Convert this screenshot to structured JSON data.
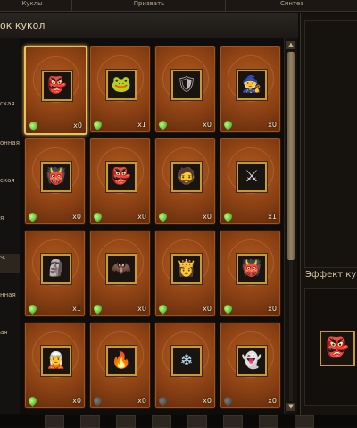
{
  "tabs": [
    {
      "label": "Куклы",
      "active": true
    },
    {
      "label": "Призвать",
      "active": false
    },
    {
      "label": "Синтез",
      "active": false
    }
  ],
  "header": {
    "title": "ок кукол"
  },
  "left_items": [
    {
      "label": "ская",
      "active": false
    },
    {
      "label": "онная",
      "active": false
    },
    {
      "label": "ская",
      "active": false
    },
    {
      "label": "я",
      "active": false
    },
    {
      "label": "ч.",
      "active": true
    },
    {
      "label": "нная",
      "active": false
    },
    {
      "label": "ая",
      "active": false
    }
  ],
  "dolls": [
    {
      "icon": "blue-imp-icon",
      "glyph": "👺",
      "color": "#5d8fd6",
      "count": "x0",
      "status": "on",
      "selected": true
    },
    {
      "icon": "frog-icon",
      "glyph": "🐸",
      "color": "#6fb04a",
      "count": "x1",
      "status": "on",
      "selected": false
    },
    {
      "icon": "armored-knight-icon",
      "glyph": "🛡",
      "color": "#b9b9b9",
      "count": "x0",
      "status": "on",
      "selected": false
    },
    {
      "icon": "witch-icon",
      "glyph": "🧙",
      "color": "#b07ad8",
      "count": "x0",
      "status": "on",
      "selected": false
    },
    {
      "icon": "red-demon-icon",
      "glyph": "👹",
      "color": "#d84b3a",
      "count": "x0",
      "status": "on",
      "selected": false
    },
    {
      "icon": "goblin-icon",
      "glyph": "👺",
      "color": "#7aa048",
      "count": "x0",
      "status": "on",
      "selected": false
    },
    {
      "icon": "dwarf-icon",
      "glyph": "🧔",
      "color": "#e8e0c8",
      "count": "x0",
      "status": "on",
      "selected": false
    },
    {
      "icon": "silver-knight-icon",
      "glyph": "⚔",
      "color": "#d8d8e8",
      "count": "x1",
      "status": "on",
      "selected": false
    },
    {
      "icon": "stone-golem-icon",
      "glyph": "🗿",
      "color": "#a8a08a",
      "count": "x1",
      "status": "on",
      "selected": false
    },
    {
      "icon": "dark-warlord-icon",
      "glyph": "🦇",
      "color": "#b05050",
      "count": "x0",
      "status": "on",
      "selected": false
    },
    {
      "icon": "warrior-woman-icon",
      "glyph": "👸",
      "color": "#d8a080",
      "count": "x0",
      "status": "on",
      "selected": false
    },
    {
      "icon": "orc-icon",
      "glyph": "👹",
      "color": "#c8905a",
      "count": "x0",
      "status": "on",
      "selected": false
    },
    {
      "icon": "mage-icon",
      "glyph": "🧝",
      "color": "#c8c8d8",
      "count": "x0",
      "status": "on",
      "selected": false
    },
    {
      "icon": "fire-spirit-icon",
      "glyph": "🔥",
      "color": "#ff8a2a",
      "count": "x0",
      "status": "off",
      "selected": false
    },
    {
      "icon": "ice-golem-icon",
      "glyph": "❄",
      "color": "#bfe4ff",
      "count": "x0",
      "status": "off",
      "selected": false
    },
    {
      "icon": "ghost-icon",
      "glyph": "👻",
      "color": "#cfe9b8",
      "count": "x0",
      "status": "off",
      "selected": false
    }
  ],
  "scrollbar": {
    "up_icon": "arrow-up-icon",
    "down_icon": "arrow-down-icon"
  },
  "effect": {
    "title": "Эффект кук",
    "icon": "blue-imp-icon",
    "glyph": "👺",
    "color": "#5d8fd6"
  }
}
